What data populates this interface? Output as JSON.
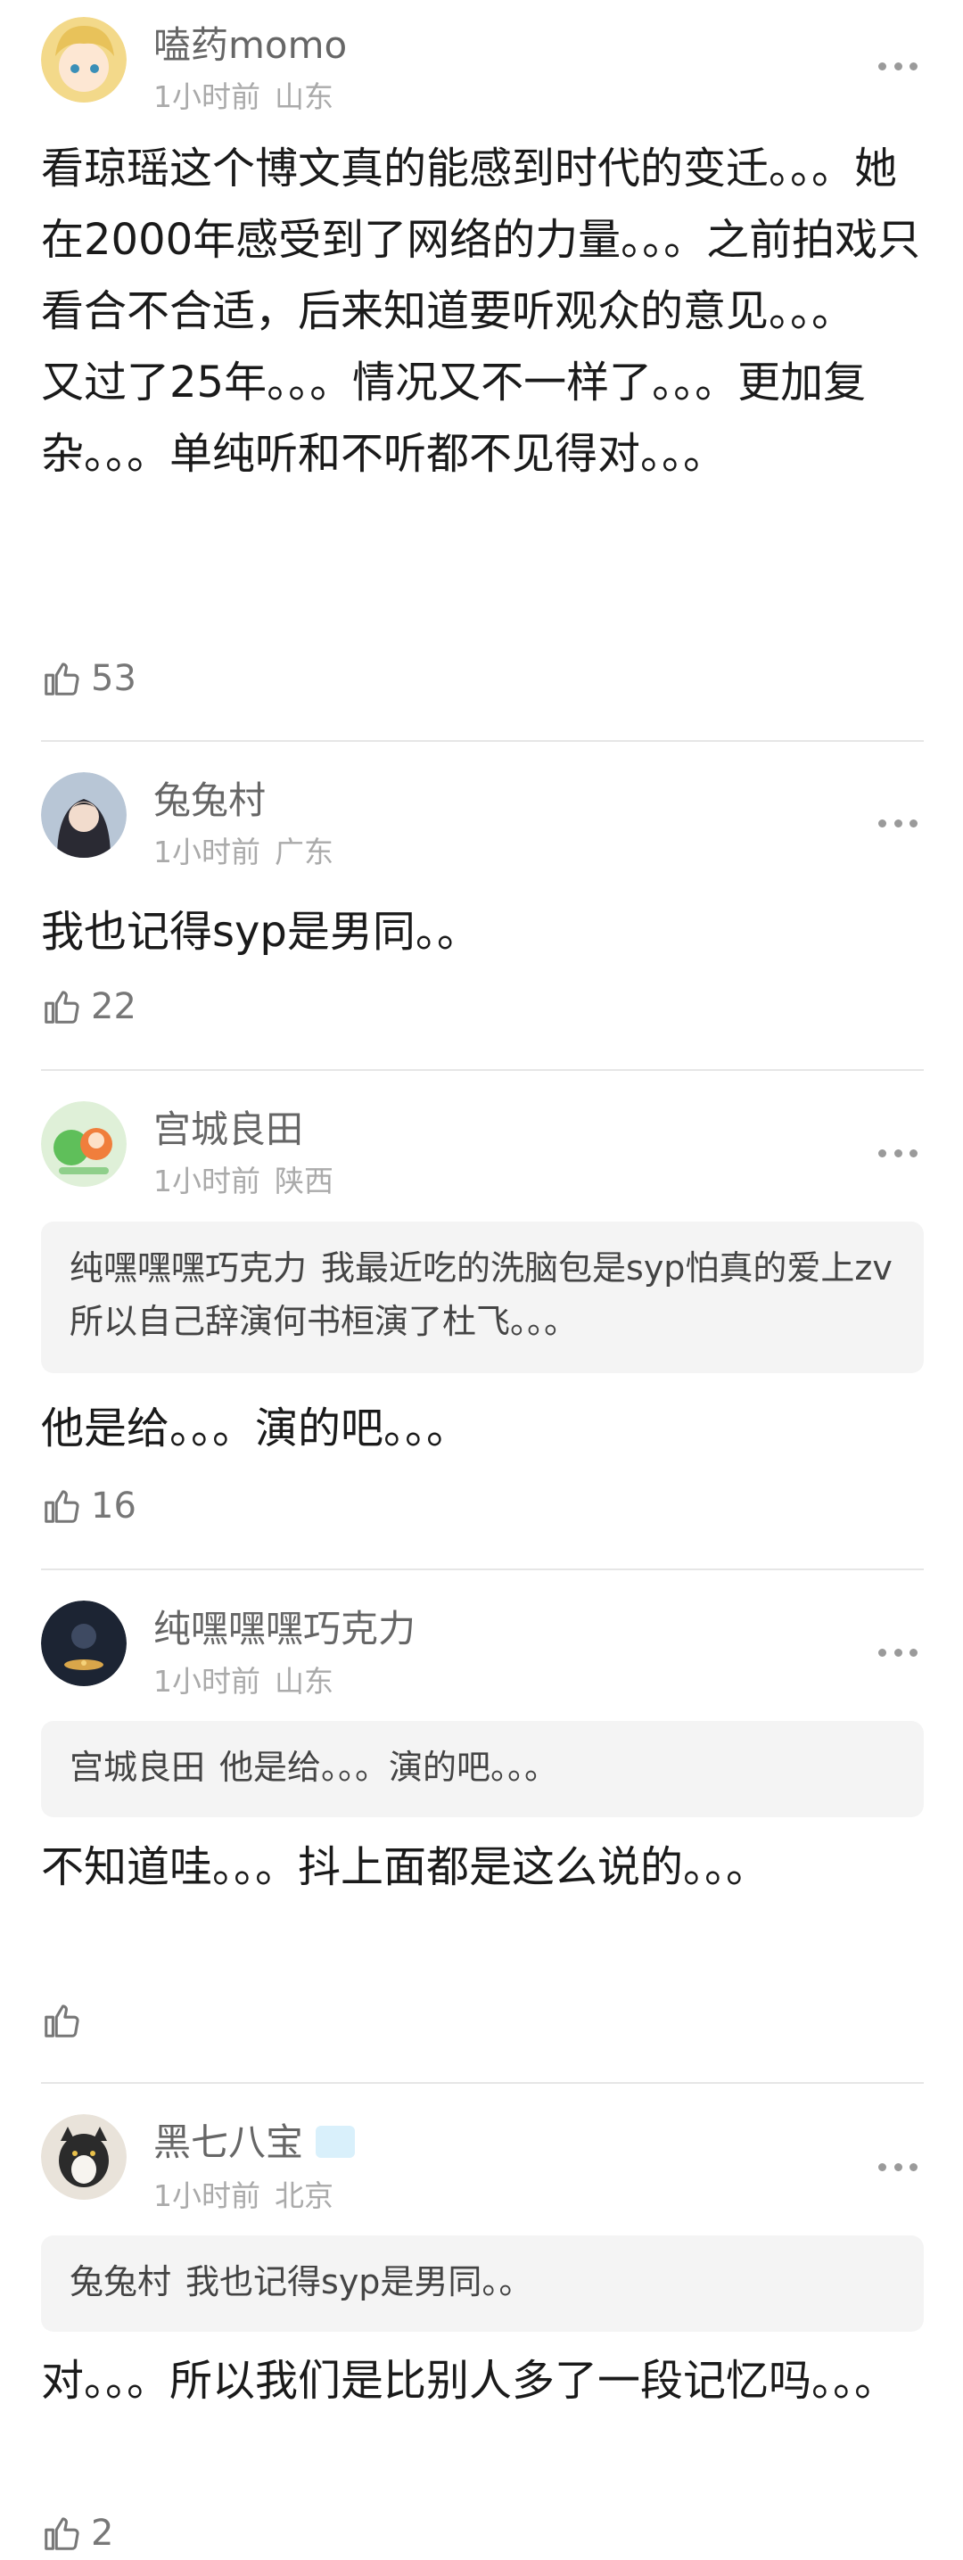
{
  "comments": [
    {
      "username": "嗑药momo",
      "time": "1小时前",
      "location": "山东",
      "text": "看琼瑶这个博文真的能感到时代的变迁。。。她在2000年感受到了网络的力量。。。之前拍戏只看合不合适，后来知道要听观众的意见。。。\n又过了25年。。。情况又不一样了。。。更加复杂。。。单纯听和不听都不见得对。。。",
      "likes": "53"
    },
    {
      "username": "兔兔村",
      "time": "1小时前",
      "location": "广东",
      "text": "我也记得syp是男同。。",
      "likes": "22"
    },
    {
      "username": "宫城良田",
      "time": "1小时前",
      "location": "陕西",
      "quote_name": "纯嘿嘿嘿巧克力",
      "quote_text": "我最近吃的洗脑包是syp怕真的爱上zv所以自己辞演何书桓演了杜飞。。。",
      "text": "他是给。。。演的吧。。。",
      "likes": "16"
    },
    {
      "username": "纯嘿嘿嘿巧克力",
      "time": "1小时前",
      "location": "山东",
      "quote_name": "宫城良田",
      "quote_text": "他是给。。。演的吧。。。",
      "text": "不知道哇。。。抖上面都是这么说的。。。",
      "likes": ""
    },
    {
      "username": "黑七八宝",
      "time": "1小时前",
      "location": "北京",
      "quote_name": "兔兔村",
      "quote_text": "我也记得syp是男同。。",
      "text": "对。。。所以我们是比别人多了一段记忆吗。。。",
      "likes": "2"
    }
  ],
  "colors": {
    "username": "#666666",
    "meta": "#aaaaaa",
    "body_text": "#1a1a1a",
    "quote_bg": "#f4f4f4",
    "divider": "#e6e6e6",
    "badge": "#d9f0fb"
  },
  "icons": {
    "like": "thumbs-up-icon",
    "more": "more-options-icon",
    "badge": "member-badge-icon"
  }
}
